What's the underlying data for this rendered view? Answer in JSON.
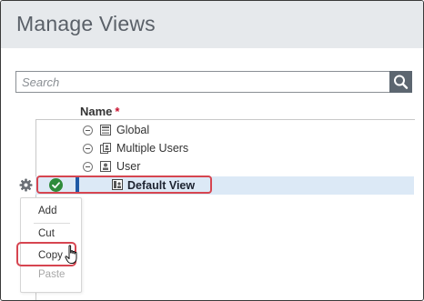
{
  "window": {
    "title": "Manage Views"
  },
  "search": {
    "placeholder": "Search",
    "value": ""
  },
  "columns": {
    "name_label": "Name",
    "required_marker": "*"
  },
  "tree": {
    "items": [
      {
        "label": "Global"
      },
      {
        "label": "Multiple Users"
      },
      {
        "label": "User"
      }
    ],
    "selected": {
      "label": "Default View"
    }
  },
  "context_menu": {
    "items": [
      {
        "label": "Add",
        "enabled": true
      },
      {
        "label": "Cut",
        "enabled": true
      },
      {
        "label": "Copy",
        "enabled": true
      },
      {
        "label": "Paste",
        "enabled": false
      }
    ]
  },
  "colors": {
    "highlight": "#d64550",
    "selection_bar": "#1f5aa6",
    "check": "#2e8b3a",
    "required": "#c8102e"
  }
}
